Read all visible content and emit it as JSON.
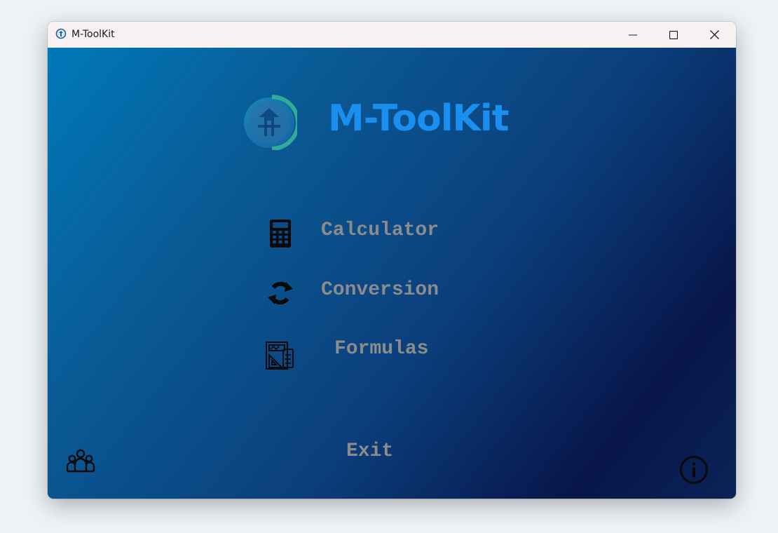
{
  "window": {
    "title": "M-ToolKit",
    "controls": {
      "minimize_icon": "minimize-icon",
      "maximize_icon": "maximize-icon",
      "close_icon": "close-icon"
    }
  },
  "header": {
    "logo_icon": "app-logo-icon",
    "title": "M-ToolKit"
  },
  "menu": {
    "items": [
      {
        "label": "Calculator",
        "icon": "calculator-icon"
      },
      {
        "label": "Conversion",
        "icon": "refresh-arrows-icon"
      },
      {
        "label": "Formulas",
        "icon": "formulas-icon"
      }
    ],
    "exit_label": "Exit"
  },
  "footer": {
    "team_icon": "team-icon",
    "info_icon": "info-icon"
  },
  "colors": {
    "title_accent": "#1a8ff0",
    "menu_text": "#8c8c8c",
    "gradient_start": "#0079b9",
    "gradient_end": "#08164a"
  }
}
